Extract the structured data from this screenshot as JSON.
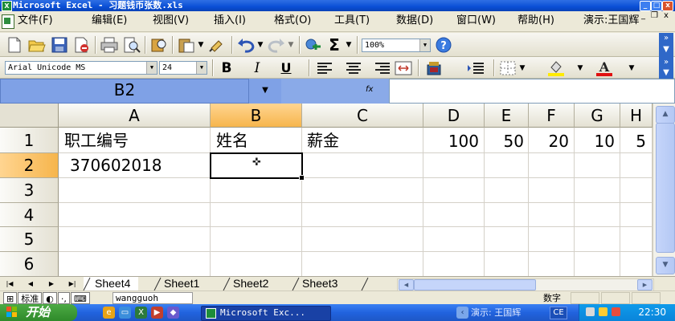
{
  "window": {
    "title": "Microsoft Excel - 习题钱币张数.xls",
    "buttons": {
      "minimize": "_",
      "maximize": "□",
      "close": "x"
    }
  },
  "menubar": {
    "items": [
      "文件(F)",
      "编辑(E)",
      "视图(V)",
      "插入(I)",
      "格式(O)",
      "工具(T)",
      "数据(D)",
      "窗口(W)",
      "帮助(H)"
    ],
    "right_text": "演示:王国辉",
    "doc_controls": {
      "minimize": "_",
      "restore": "❐",
      "close": "x"
    }
  },
  "toolbar1": {
    "icons": [
      "new-icon",
      "open-icon",
      "save-icon",
      "permission-icon",
      "print-icon",
      "print-preview-icon",
      "research-icon",
      "paste-icon",
      "format-painter-icon",
      "undo-icon",
      "redo-icon",
      "hyperlink-icon",
      "autosum-icon",
      "help-icon"
    ],
    "zoom": "100%"
  },
  "toolbar2": {
    "font": "Arial Unicode MS",
    "size": "24",
    "bold": "B",
    "italic": "I",
    "underline": "U"
  },
  "formulabar": {
    "name_box": "B2",
    "fx": "fx",
    "formula": ""
  },
  "grid": {
    "columns": [
      "A",
      "B",
      "C",
      "D",
      "E",
      "F",
      "G",
      "H"
    ],
    "selected_column": "B",
    "rows": [
      "1",
      "2",
      "3",
      "4",
      "5",
      "6"
    ],
    "selected_row": "2",
    "cells": {
      "A1": "职工编号",
      "B1": "姓名",
      "C1": "薪金",
      "D1": "100",
      "E1": "50",
      "F1": "20",
      "G1": "10",
      "H1": "5",
      "A2": "370602018"
    },
    "active_cell": "B2"
  },
  "sheets": {
    "tabs": [
      "Sheet4",
      "Sheet1",
      "Sheet2",
      "Sheet3"
    ],
    "active": "Sheet4"
  },
  "statusbar": {
    "ime_mode": "标准",
    "user": "wangguoh",
    "mode": "数字"
  },
  "taskbar": {
    "start_label": "开始",
    "task": "Microsoft Exc...",
    "tray_ime": "演示: 王国辉",
    "lang": "CE",
    "clock": "22:30"
  }
}
